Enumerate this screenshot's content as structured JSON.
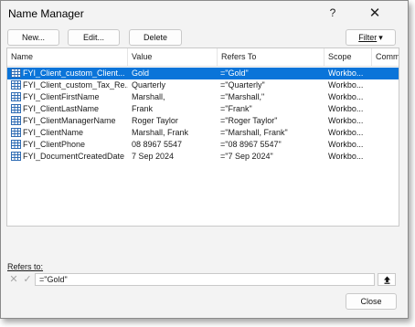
{
  "window": {
    "title": "Name Manager"
  },
  "icons": {
    "help": "?",
    "close": "✕",
    "dropdown": "▾",
    "cancel": "✕",
    "confirm": "✓"
  },
  "toolbar": {
    "new_label": "New...",
    "edit_label": "Edit...",
    "delete_label": "Delete",
    "filter_label": "Filter"
  },
  "table": {
    "headers": [
      "Name",
      "Value",
      "Refers To",
      "Scope",
      "Comm"
    ],
    "rows": [
      {
        "name": "FYI_Client_custom_Client...",
        "value": "Gold",
        "refers": "=\"Gold\"",
        "scope": "Workbo..."
      },
      {
        "name": "FYI_Client_custom_Tax_Re...",
        "value": "Quarterly",
        "refers": "=\"Quarterly\"",
        "scope": "Workbo..."
      },
      {
        "name": "FYI_ClientFirstName",
        "value": "Marshall,",
        "refers": "=\"Marshall,\"",
        "scope": "Workbo..."
      },
      {
        "name": "FYI_ClientLastName",
        "value": "Frank",
        "refers": "=\"Frank\"",
        "scope": "Workbo..."
      },
      {
        "name": "FYI_ClientManagerName",
        "value": "Roger Taylor",
        "refers": "=\"Roger Taylor\"",
        "scope": "Workbo..."
      },
      {
        "name": "FYI_ClientName",
        "value": "Marshall, Frank",
        "refers": "=\"Marshall, Frank\"",
        "scope": "Workbo..."
      },
      {
        "name": "FYI_ClientPhone",
        "value": "08 8967 5547",
        "refers": "=\"08 8967 5547\"",
        "scope": "Workbo..."
      },
      {
        "name": "FYI_DocumentCreatedDate",
        "value": "7 Sep 2024",
        "refers": "=\"7 Sep 2024\"",
        "scope": "Workbo..."
      }
    ]
  },
  "refers_to": {
    "label": "Refers to:",
    "value": "=\"Gold\""
  },
  "footer": {
    "close_label": "Close"
  },
  "colors": {
    "selection": "#0a74d9",
    "window_bg": "#f3f3f3"
  }
}
